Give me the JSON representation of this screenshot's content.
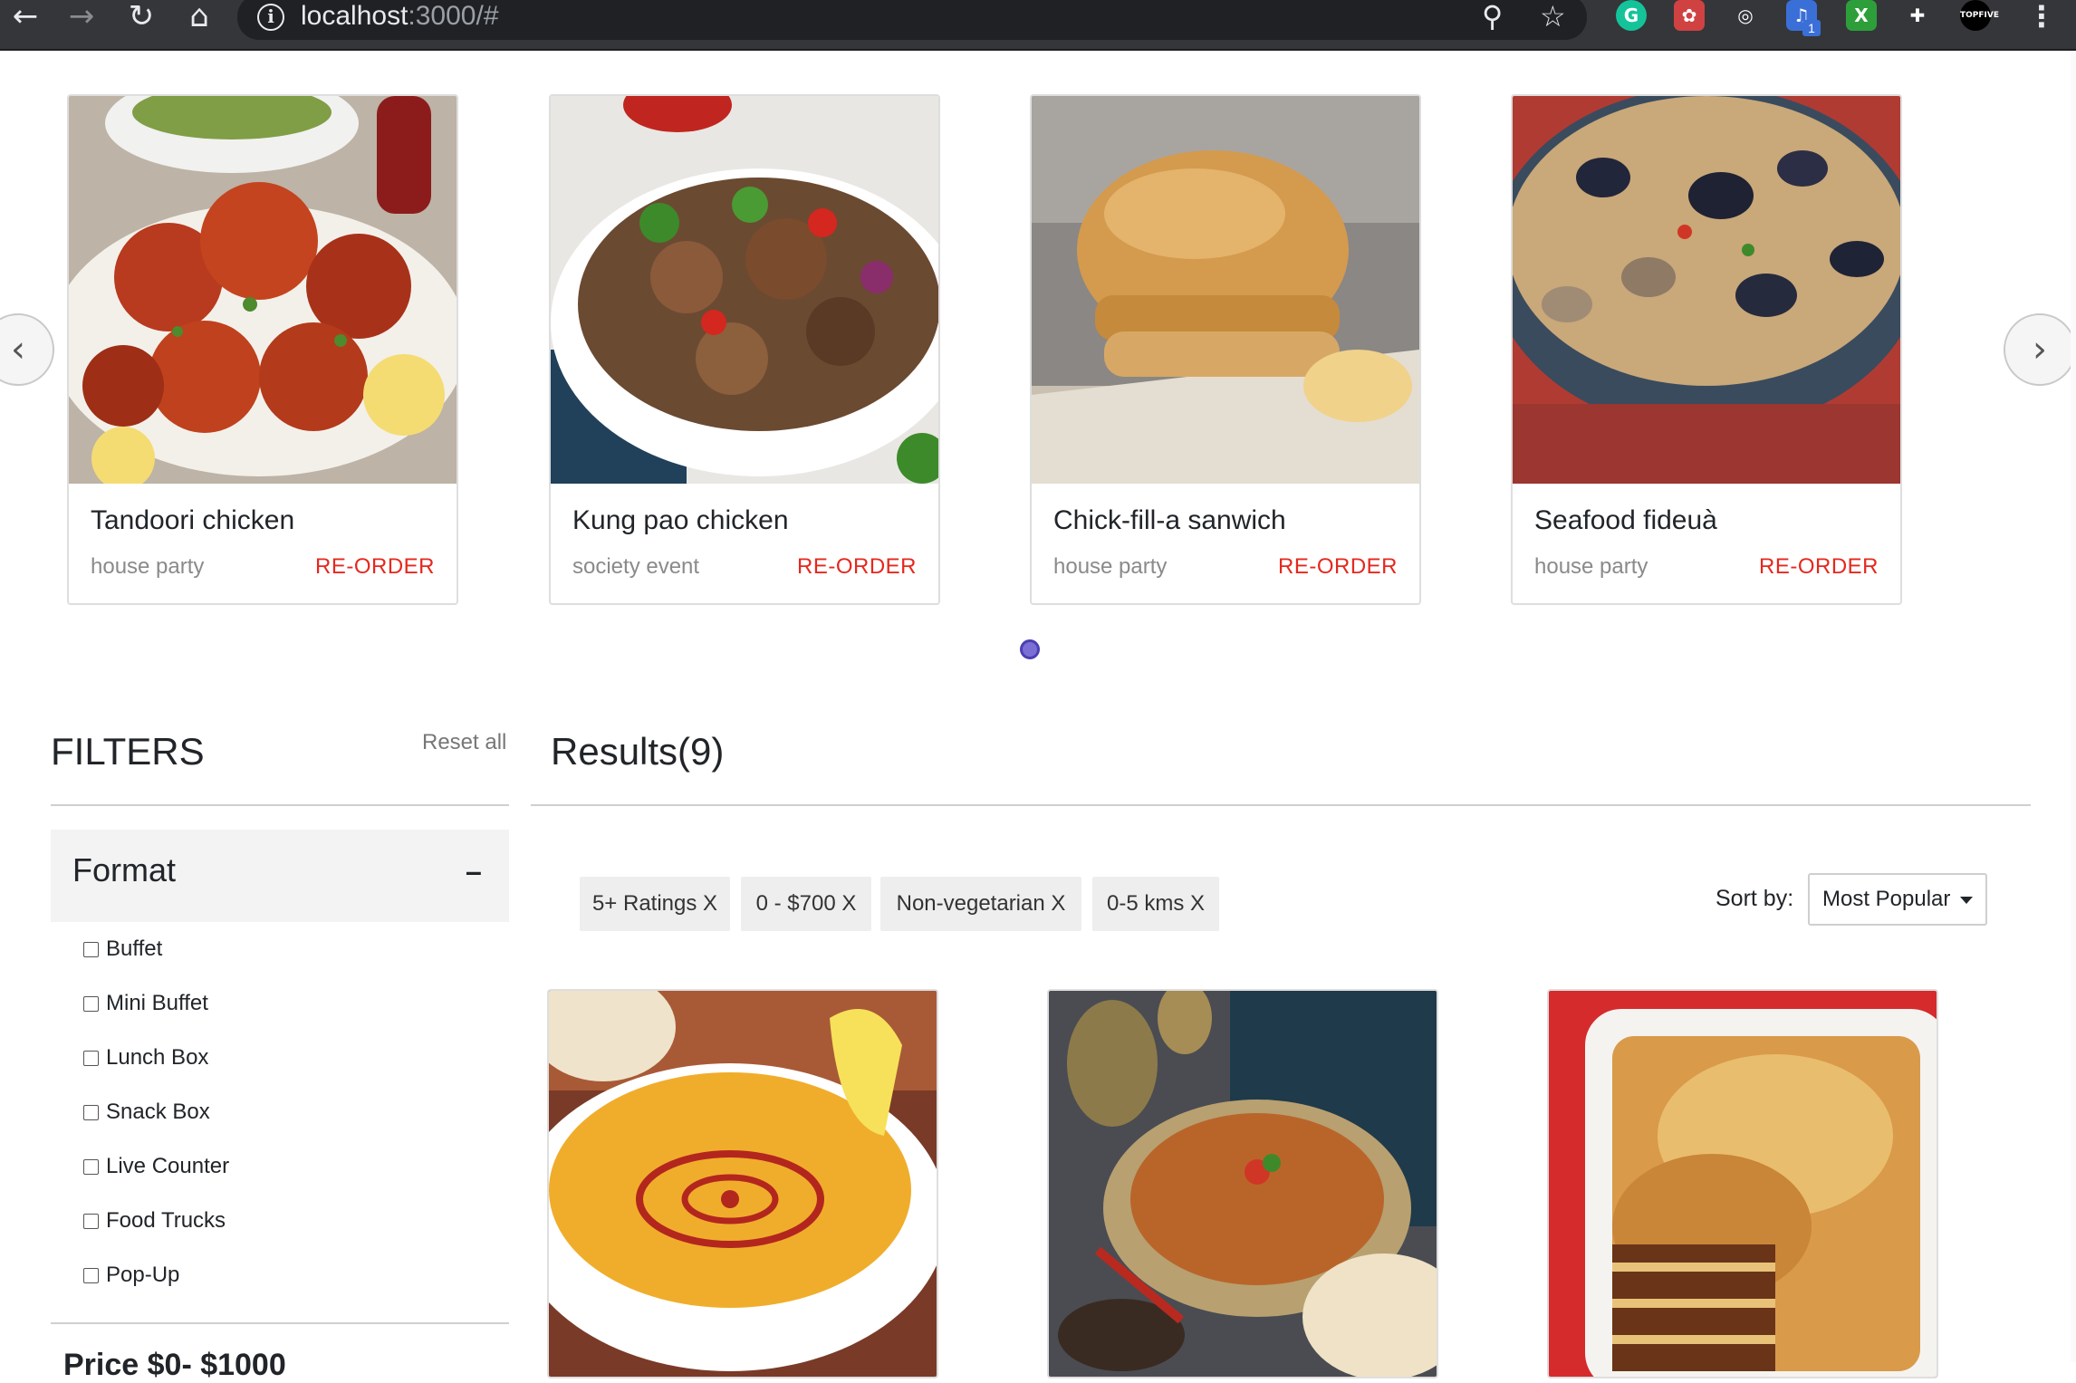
{
  "browser": {
    "url_host": "localhost",
    "url_rest": ":3000/#",
    "back_icon": "arrow-left-icon",
    "forward_icon": "arrow-right-icon",
    "reload_icon": "reload-icon",
    "home_icon": "home-icon",
    "info_icon": "info-icon",
    "zoom_icon": "zoom-icon",
    "star_icon": "star-icon",
    "extensions": [
      {
        "name": "grammarly-extension-icon",
        "glyph": "G",
        "color": "#15c39a"
      },
      {
        "name": "red-extension-icon",
        "glyph": "✿",
        "color": "#d04242"
      },
      {
        "name": "target-extension-icon",
        "glyph": "◎",
        "color": "#35363a"
      },
      {
        "name": "music-extension-icon",
        "glyph": "♫",
        "color": "#3b6fd8"
      },
      {
        "name": "green-extension-icon",
        "glyph": "X",
        "color": "#2e9e3a"
      },
      {
        "name": "puzzle-extension-icon",
        "glyph": "✚",
        "color": "#35363a"
      },
      {
        "name": "topfive-extension-icon",
        "glyph": "TOPFIVE",
        "color": "#000000"
      }
    ],
    "badge_count": "1",
    "menu_icon": "more-vertical-icon"
  },
  "carousel": {
    "prev_label": "‹",
    "next_label": "›",
    "items": [
      {
        "title": "Tandoori chicken",
        "event": "house party",
        "action": "RE-ORDER"
      },
      {
        "title": "Kung pao chicken",
        "event": "society event",
        "action": "RE-ORDER"
      },
      {
        "title": "Chick-fill-a sanwich",
        "event": "house party",
        "action": "RE-ORDER"
      },
      {
        "title": "Seafood fideuà",
        "event": "house party",
        "action": "RE-ORDER"
      }
    ]
  },
  "filters": {
    "title": "FILTERS",
    "reset_label": "Reset all",
    "format": {
      "title": "Format",
      "toggle": "–",
      "options": [
        "Buffet",
        "Mini Buffet",
        "Lunch Box",
        "Snack Box",
        "Live Counter",
        "Food Trucks",
        "Pop-Up"
      ]
    },
    "price_title": "Price $0- $1000"
  },
  "results": {
    "title": "Results(9)",
    "chips": [
      "5+ Ratings X",
      "0 - $700 X",
      "Non-vegetarian X",
      "0-5 kms X"
    ],
    "sort_label": "Sort by:",
    "sort_value": "Most Popular"
  },
  "colors": {
    "accent_red": "#e5281e",
    "chip_bg": "#eeeeee",
    "dot": "#7b6fd6"
  }
}
